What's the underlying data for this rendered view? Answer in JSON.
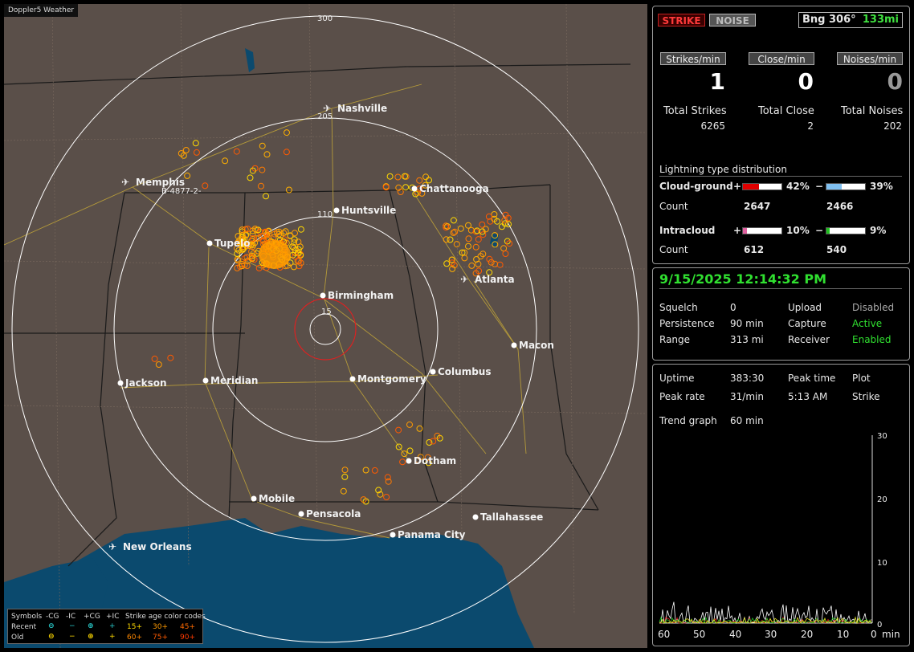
{
  "app": {
    "title": "Doppler5 Weather"
  },
  "map": {
    "ring_labels": [
      "300",
      "205",
      "110",
      "15"
    ],
    "cities": [
      "Nashville",
      "Memphis",
      "Chattanooga",
      "Huntsville",
      "Tupelo",
      "Birmingham",
      "Atlanta",
      "Jackson",
      "Meridian",
      "Montgomery",
      "Columbus",
      "Macon",
      "Dotham",
      "Mobile",
      "Pensacola",
      "Panama City",
      "Tallahassee",
      "New Orleans"
    ],
    "strike_label": "B-4877-2-",
    "colors": {
      "land": "#5a4f49",
      "water": "#0b4a6e",
      "rings": "#ffffff",
      "roads": "#b49a3a",
      "center": "#e02020"
    }
  },
  "legend": {
    "symbols_label": "Symbols",
    "headers": [
      "-CG",
      "-IC",
      "+CG",
      "+IC"
    ],
    "rows": [
      "Recent",
      "Old"
    ],
    "age_title": "Strike age color codes",
    "recent_ages": [
      "15+",
      "30+",
      "45+"
    ],
    "old_ages": [
      "60+",
      "75+",
      "90+"
    ],
    "age_colors": [
      "#ffd900",
      "#ff9a00",
      "#ff6a00"
    ]
  },
  "stats": {
    "strike_btn": "STRIKE",
    "noise_btn": "NOISE",
    "bearing": "Bng 306°",
    "distance": "133mi",
    "strikes_min_label": "Strikes/min",
    "close_min_label": "Close/min",
    "noises_min_label": "Noises/min",
    "strikes_min": "1",
    "close_min": "0",
    "noises_min": "0",
    "total_strikes_label": "Total Strikes",
    "total_close_label": "Total Close",
    "total_noises_label": "Total Noises",
    "total_strikes": "6265",
    "total_close": "2",
    "total_noises": "202",
    "dist_title": "Lightning type distribution",
    "cg_label": "Cloud-ground",
    "ic_label": "Intracloud",
    "count_label": "Count",
    "plus": "+",
    "minus": "−",
    "cg_plus_pct": "42%",
    "cg_minus_pct": "39%",
    "cg_plus_count": "2647",
    "cg_minus_count": "2466",
    "ic_plus_pct": "10%",
    "ic_minus_pct": "9%",
    "ic_plus_count": "612",
    "ic_minus_count": "540",
    "cg_plus_fill": 0.42,
    "cg_minus_fill": 0.39,
    "ic_plus_fill": 0.1,
    "ic_minus_fill": 0.09
  },
  "status": {
    "datetime": "9/15/2025 12:14:32 PM",
    "squelch_label": "Squelch",
    "squelch": "0",
    "persistence_label": "Persistence",
    "persistence": "90 min",
    "range_label": "Range",
    "range": "313 mi",
    "upload_label": "Upload",
    "upload": "Disabled",
    "capture_label": "Capture",
    "capture": "Active",
    "receiver_label": "Receiver",
    "receiver": "Enabled"
  },
  "trend": {
    "uptime_label": "Uptime",
    "uptime": "383:30",
    "peak_time_label": "Peak time",
    "peak_time": "5:13 AM",
    "plot_label": "Plot",
    "plot": "Strike",
    "peak_rate_label": "Peak rate",
    "peak_rate": "31/min",
    "graph_label": "Trend graph",
    "graph_span": "60 min",
    "y_ticks": [
      "30",
      "20",
      "10",
      "0"
    ],
    "x_ticks": [
      "60",
      "50",
      "40",
      "30",
      "20",
      "10",
      "0"
    ],
    "x_unit": "min"
  }
}
